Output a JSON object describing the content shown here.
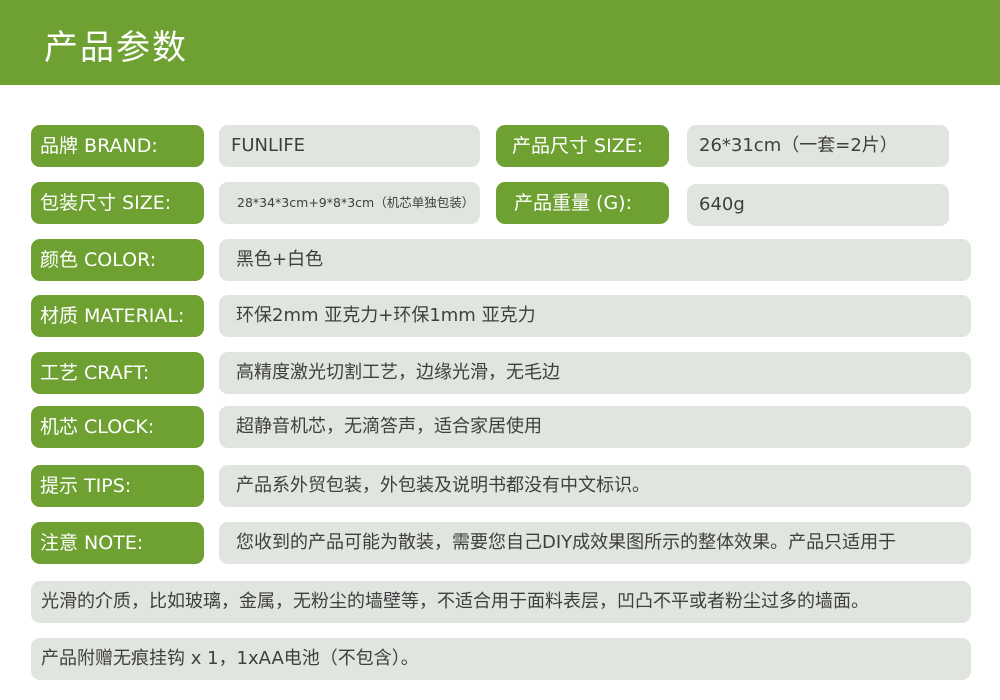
{
  "header": {
    "title": "产品参数"
  },
  "specs": {
    "brand": {
      "label": "品牌 BRAND:",
      "value": "FUNLIFE"
    },
    "product_size": {
      "label": "产品尺寸 SIZE:",
      "value": "26*31cm（一套=2片）"
    },
    "package_size": {
      "label": "包装尺寸 SIZE:",
      "value": "28*34*3cm+9*8*3cm（机芯单独包装）"
    },
    "weight": {
      "label": "产品重量 (G):",
      "value": "640g"
    },
    "color": {
      "label": "颜色 COLOR:",
      "value": "黑色+白色"
    },
    "material": {
      "label": "材质 MATERIAL:",
      "value": "环保2mm 亚克力+环保1mm 亚克力"
    },
    "craft": {
      "label": "工艺 CRAFT:",
      "value": "高精度激光切割工艺，边缘光滑，无毛边"
    },
    "clock": {
      "label": "机芯 CLOCK:",
      "value": "超静音机芯，无滴答声，适合家居使用"
    },
    "tips": {
      "label": "提示  TIPS:",
      "value": "产品系外贸包装，外包装及说明书都没有中文标识。"
    },
    "note": {
      "label": "注意  NOTE:",
      "value": "您收到的产品可能为散装，需要您自己DIY成效果图所示的整体效果。产品只适用于",
      "line2": "光滑的介质，比如玻璃，金属，无粉尘的墙壁等，不适合用于面料表层，凹凸不平或者粉尘过多的墙面。",
      "line3": "产品附赠无痕挂钩 x 1，1xAA电池（不包含）。"
    }
  },
  "colors": {
    "accent": "#6ea132",
    "field_bg": "#e1e5df",
    "text": "#3f3f3f"
  }
}
